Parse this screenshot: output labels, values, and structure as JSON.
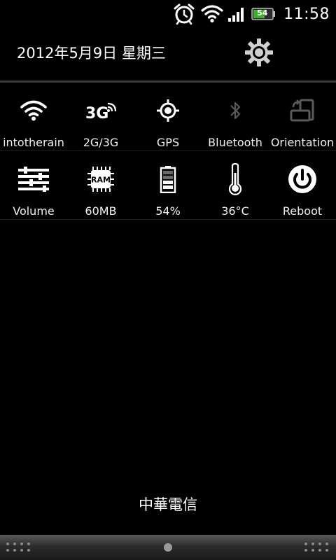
{
  "status_bar": {
    "time": "11:58",
    "battery_level": "54",
    "icons": [
      "alarm-icon",
      "wifi-icon",
      "signal-icon",
      "battery-icon"
    ]
  },
  "header": {
    "date": "2012年5月9日 星期三"
  },
  "tiles": [
    {
      "label": "intotherain",
      "icon": "wifi-icon",
      "state": "on"
    },
    {
      "label": "2G/3G",
      "icon": "3g-icon",
      "state": "on"
    },
    {
      "label": "GPS",
      "icon": "gps-icon",
      "state": "on"
    },
    {
      "label": "Bluetooth",
      "icon": "bluetooth-icon",
      "state": "off"
    },
    {
      "label": "Orientation",
      "icon": "orientation-icon",
      "state": "off"
    },
    {
      "label": "Volume",
      "icon": "volume-sliders-icon",
      "state": "on"
    },
    {
      "label": "60MB",
      "icon": "ram-icon",
      "state": "on"
    },
    {
      "label": "54%",
      "icon": "battery-icon",
      "state": "on"
    },
    {
      "label": "36°C",
      "icon": "thermometer-icon",
      "state": "on"
    },
    {
      "label": "Reboot",
      "icon": "power-icon",
      "state": "on"
    }
  ],
  "ram_chip_text": "RAM",
  "carrier": "中華電信",
  "colors": {
    "background": "#000000",
    "icon_active": "#ffffff",
    "icon_inactive": "#5a5a5a",
    "battery_green": "#3fae2a"
  }
}
